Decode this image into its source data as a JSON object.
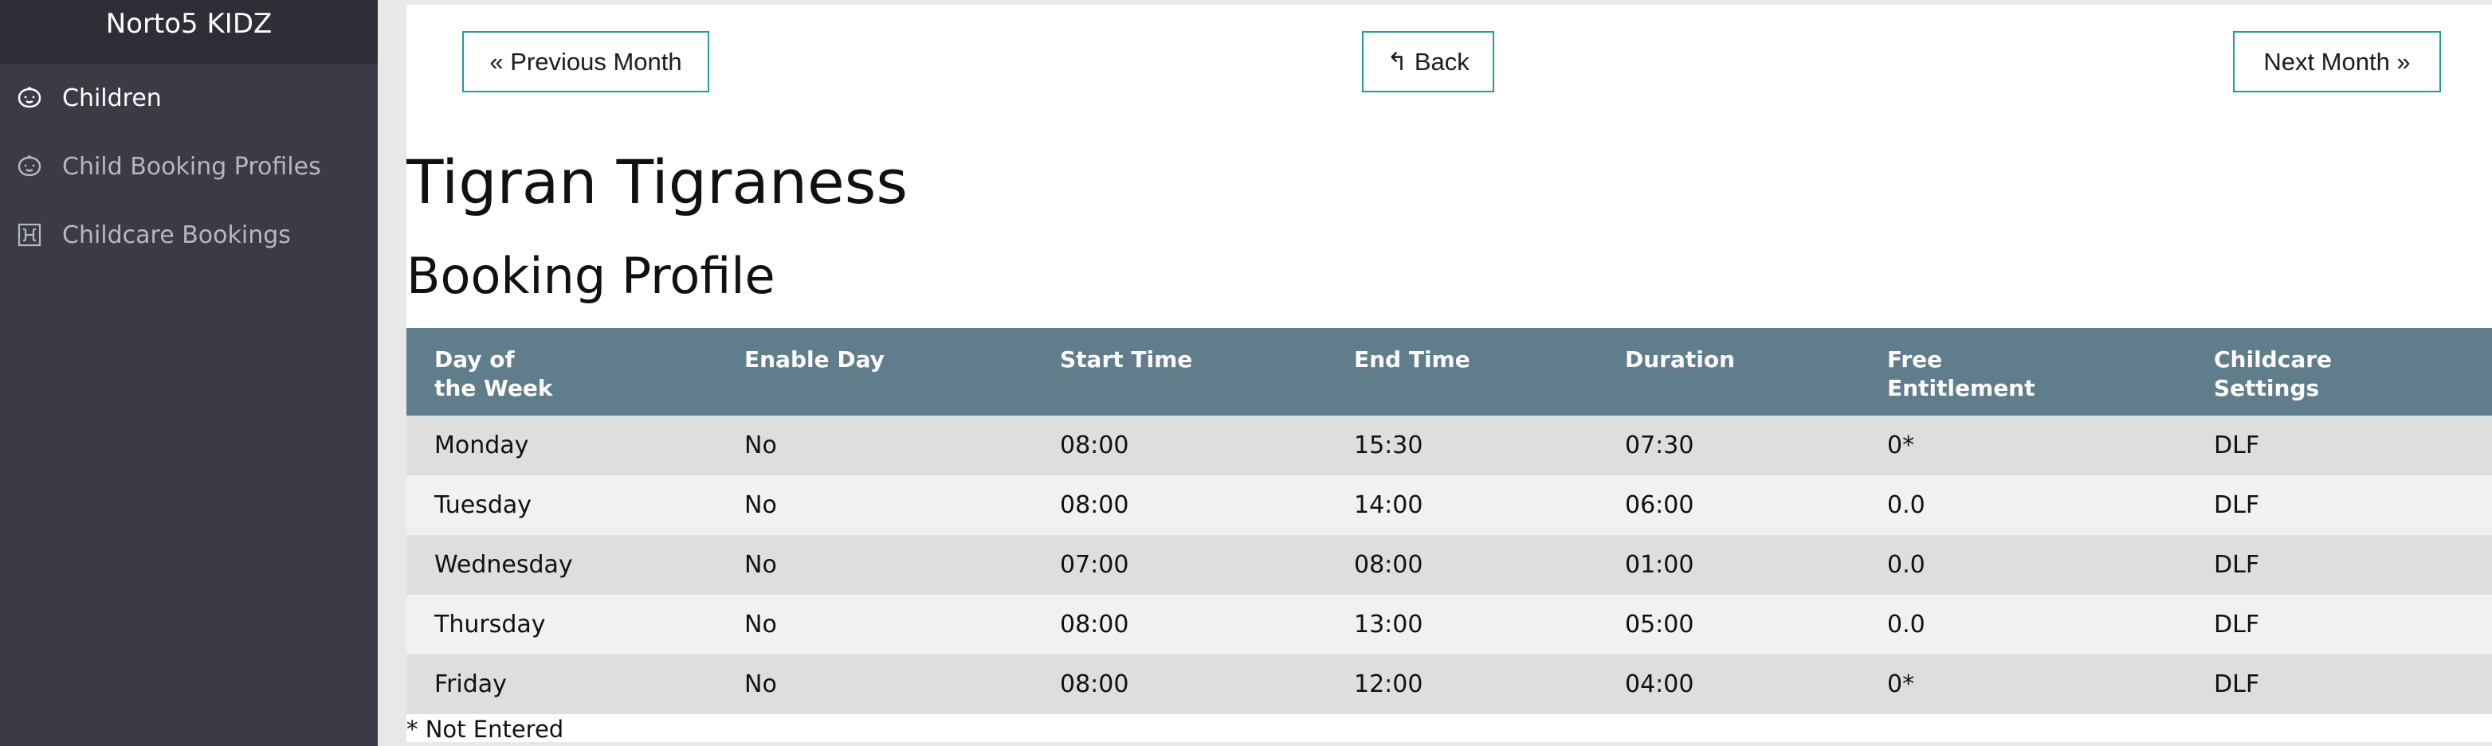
{
  "sidebar": {
    "brand": "Norto5 KIDZ",
    "items": [
      {
        "label": "Children",
        "icon": "child-face-icon",
        "active": true
      },
      {
        "label": "Child Booking Profiles",
        "icon": "child-face-icon",
        "active": false
      },
      {
        "label": "Childcare Bookings",
        "icon": "calendar-h-icon",
        "active": false
      }
    ]
  },
  "navigation": {
    "previous_label": "« Previous Month",
    "back_label": "↰ Back",
    "next_label": "Next Month »"
  },
  "child_name": "Tigran Tigraness",
  "section_title": "Booking Profile",
  "table": {
    "headers": [
      "Day of the Week",
      "Enable Day",
      "Start Time",
      "End Time",
      "Duration",
      "Free Entitlement",
      "Childcare Settings"
    ],
    "header_lines": [
      [
        "Day of",
        "the Week"
      ],
      [
        "Enable Day"
      ],
      [
        "Start Time"
      ],
      [
        "End Time"
      ],
      [
        "Duration"
      ],
      [
        "Free",
        "Entitlement"
      ],
      [
        "Childcare",
        "Settings"
      ]
    ],
    "rows": [
      [
        "Monday",
        "No",
        "08:00",
        "15:30",
        "07:30",
        "0*",
        "DLF"
      ],
      [
        "Tuesday",
        "No",
        "08:00",
        "14:00",
        "06:00",
        "0.0",
        "DLF"
      ],
      [
        "Wednesday",
        "No",
        "07:00",
        "08:00",
        "01:00",
        "0.0",
        "DLF"
      ],
      [
        "Thursday",
        "No",
        "08:00",
        "13:00",
        "05:00",
        "0.0",
        "DLF"
      ],
      [
        "Friday",
        "No",
        "08:00",
        "12:00",
        "04:00",
        "0*",
        "DLF"
      ]
    ]
  },
  "footnote": "* Not Entered",
  "colors": {
    "sidebar_bg": "#3a3b45",
    "brand_bg": "#2d2e36",
    "header_bg": "#607d8b",
    "button_border": "#1e9e9a",
    "row_odd": "#dedede",
    "row_even": "#f1f1f1"
  }
}
